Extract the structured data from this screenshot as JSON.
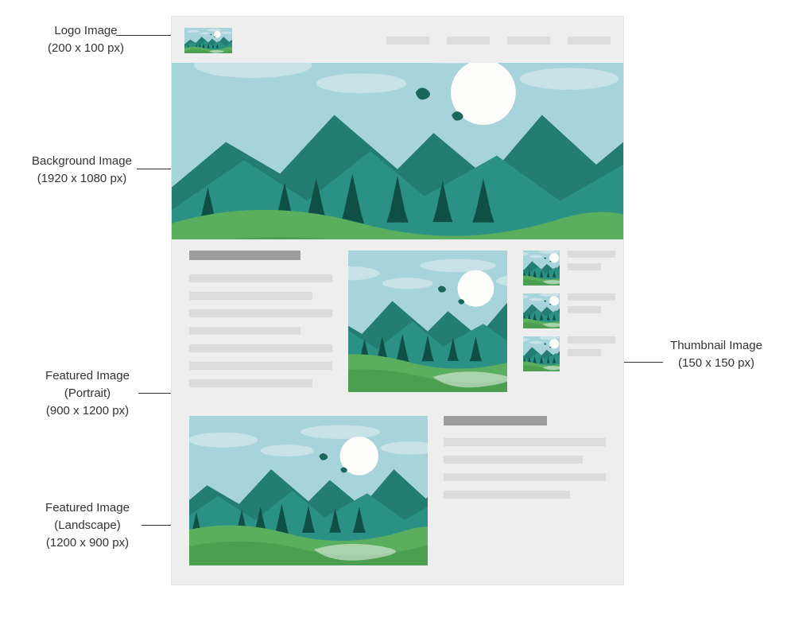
{
  "labels": {
    "logo": {
      "title": "Logo Image",
      "dim": "(200 x 100 px)"
    },
    "background": {
      "title": "Background Image",
      "dim": "(1920 x 1080 px)"
    },
    "portrait": {
      "title": "Featured Image",
      "sub": "(Portrait)",
      "dim": "(900 x 1200 px)"
    },
    "landscape": {
      "title": "Featured Image",
      "sub": "(Landscape)",
      "dim": "(1200 x 900 px)"
    },
    "thumb": {
      "title": "Thumbnail Image",
      "dim": "(150 x 150 px)"
    }
  }
}
